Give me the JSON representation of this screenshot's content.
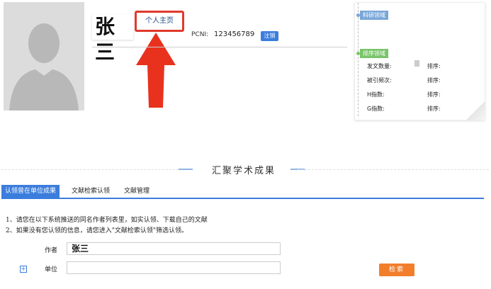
{
  "profile": {
    "name": "张三",
    "home_link": "个人主页",
    "pcni_label": "PCNI:",
    "pcni_value": "123456789",
    "logout_label": "注销"
  },
  "side_card": {
    "research_tag": "科研领域",
    "rank_tag": "排序领域",
    "stats": [
      {
        "label": "发文数量:",
        "sort_label": "排序:"
      },
      {
        "label": "被引频次:",
        "sort_label": "排序:"
      },
      {
        "label": "H指数:",
        "sort_label": "排序:"
      },
      {
        "label": "G指数:",
        "sort_label": "排序:"
      }
    ]
  },
  "section": {
    "title": "汇聚学术成果"
  },
  "tabs": [
    {
      "label": "认领曾在单位成果",
      "active": true
    },
    {
      "label": "文献检索认领",
      "active": false
    },
    {
      "label": "文献管理",
      "active": false
    }
  ],
  "instructions": [
    "1、请您在以下系统推送的同名作者列表里，如实认领、下载自己的文献",
    "2、如果没有您认领的信息，请您进入\"文献检索认领\"筛选认领。"
  ],
  "form": {
    "author_label": "作者",
    "author_value": "张三",
    "unit_label": "单位",
    "unit_value": "",
    "search_label": "检索"
  },
  "icons": {
    "plus": "plus-icon",
    "arrow": "up-arrow-annotation"
  },
  "colors": {
    "accent_blue": "#3b7ddd",
    "search_orange": "#f27e2c",
    "highlight_red": "#e03a2c"
  }
}
